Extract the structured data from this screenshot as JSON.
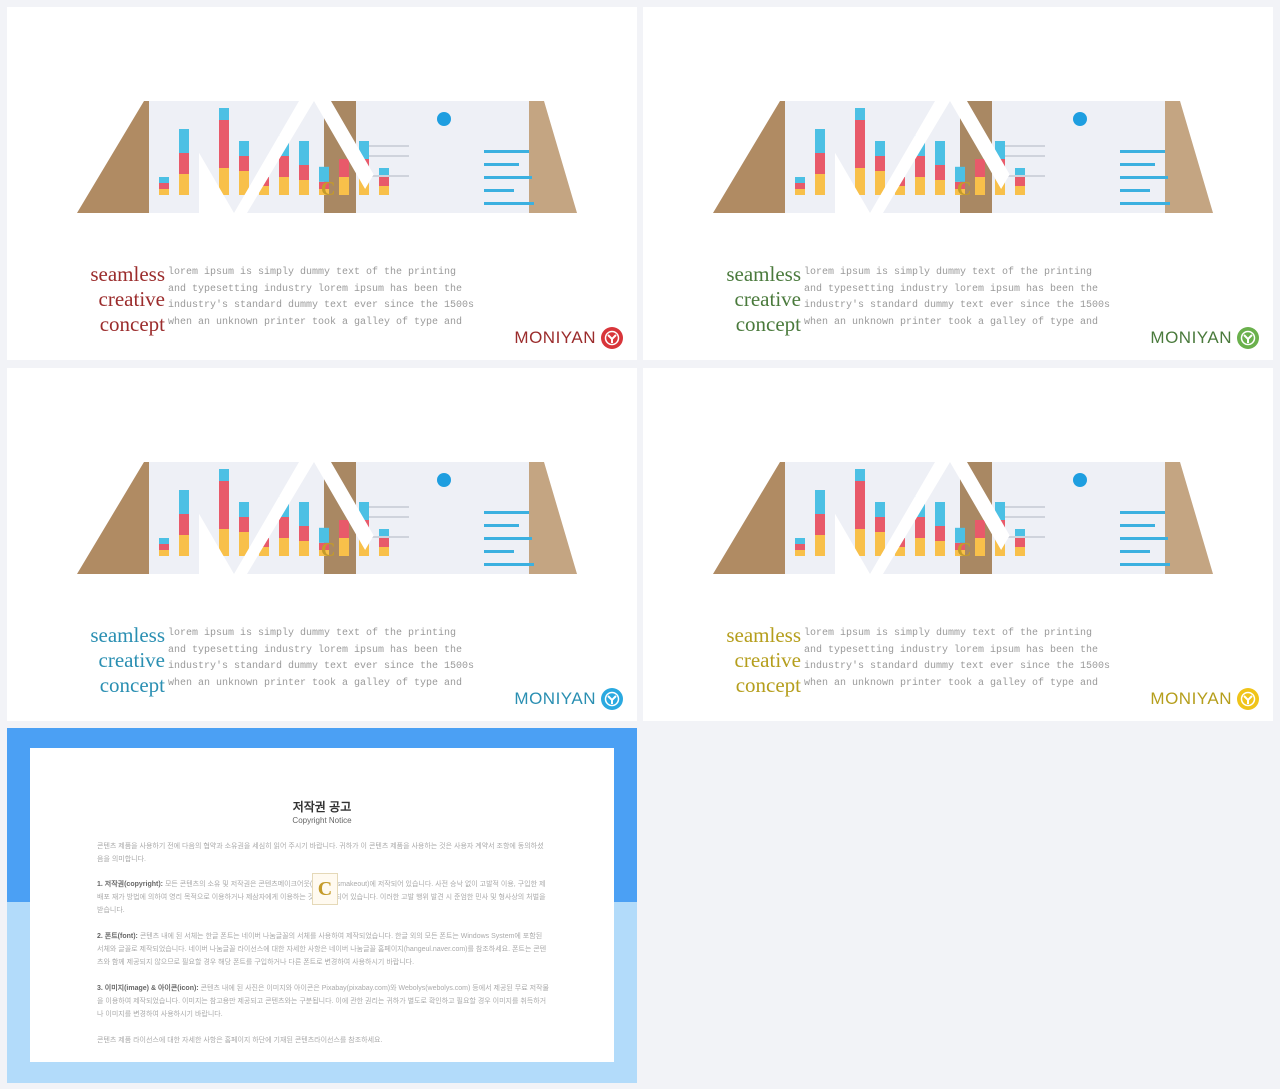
{
  "slides": [
    {
      "title_lines": [
        "seamless",
        "creative",
        "concept"
      ],
      "body_lines": [
        "lorem ipsum is simply dummy text of the printing",
        "and typesetting industry lorem ipsum has been the",
        "industry's standard dummy text ever since the 1500s",
        "when an unknown printer took a galley of type and"
      ],
      "logo": "MONIYAN",
      "accent": "#9b2c2c",
      "logo_color": "#d8353a"
    },
    {
      "title_lines": [
        "seamless",
        "creative",
        "concept"
      ],
      "body_lines": [
        "lorem ipsum is simply dummy text of the printing",
        "and typesetting industry lorem ipsum has been the",
        "industry's standard dummy text ever since the 1500s",
        "when an unknown printer took a galley of type and"
      ],
      "logo": "MONIYAN",
      "accent": "#4a7a3c",
      "logo_color": "#6ab04c"
    },
    {
      "title_lines": [
        "seamless",
        "creative",
        "concept"
      ],
      "body_lines": [
        "lorem ipsum is simply dummy text of the printing",
        "and typesetting industry lorem ipsum has been the",
        "industry's standard dummy text ever since the 1500s",
        "when an unknown printer took a galley of type and"
      ],
      "logo": "MONIYAN",
      "accent": "#2a8fb2",
      "logo_color": "#2aa9e0"
    },
    {
      "title_lines": [
        "seamless",
        "creative",
        "concept"
      ],
      "body_lines": [
        "lorem ipsum is simply dummy text of the printing",
        "and typesetting industry lorem ipsum has been the",
        "industry's standard dummy text ever since the 1500s",
        "when an unknown printer took a galley of type and"
      ],
      "logo": "MONIYAN",
      "accent": "#b59e1c",
      "logo_color": "#f0c419"
    }
  ],
  "copyright": {
    "title": "저작권 공고",
    "subtitle": "Copyright Notice",
    "intro": "콘텐츠 제품을 사용하기 전에 다음의 협약과 소유권을 세심히 읽어 주시기 바랍니다. 귀하가 이 콘텐츠 제품을 사용하는 것은 사용자 계약서 조항에 동의하셨음을 의미합니다.",
    "sections": [
      {
        "head": "1. 저작권(copyright):",
        "text": "모든 콘텐츠의 소유 및 저작권은 콘텐츠메이크어웃(Contentsmakeout)에 저작되어 있습니다. 사전 승낙 없이 고발적 이용, 구입한 제 배포 재가 방법에 의하여 영리 목적으로 이용하거나 제삼자에게 이용하는 것은 금지되어 있습니다. 이러한 고발 행위 발견 시 준엄한 민사 및 형사상의 처벌을 받습니다."
      },
      {
        "head": "2. 폰트(font):",
        "text": "콘텐츠 내에 된 서체는 한글 폰트는 네이버 나눔글꼴의 서체를 사용하여 제작되었습니다. 한글 외의 모든 폰트는 Windows System에 포함된 서체와 글꼴로 제작되었습니다. 네이버 나눔글꼴 라이선스에 대한 자세한 사항은 네이버 나눔글꼴 홈페이지(hangeul.naver.com)를 참조하세요. 폰트는 콘텐츠와 함께 제공되지 않으므로 필요할 경우 해당 폰트를 구입하거나 다른 폰트로 변경하여 사용하시기 바랍니다."
      },
      {
        "head": "3. 이미지(image) & 아이콘(icon):",
        "text": "콘텐츠 내에 된 사진은 이미지와 아이콘은 Pixabay(pixabay.com)와 Webolys(webolys.com) 등에서 제공된 무료 저작물을 이용하여 제작되었습니다. 이미지는 참고용만 제공되고 콘텐츠와는 구분됩니다. 이에 관한 권리는 귀하가 별도로 확인하고 필요할 경우 이미지를 취득하거나 이미지를 변경하여 사용하시기 바랍니다."
      }
    ],
    "footer": "콘텐츠 제품 라이선스에 대한 자세한 사항은 홈페이지 하단에 기재된 콘텐츠라이선스를 참조하세요.",
    "watermark": "C",
    "top_color": "#4ba0f4",
    "bottom_color": "#b2dbfa"
  }
}
